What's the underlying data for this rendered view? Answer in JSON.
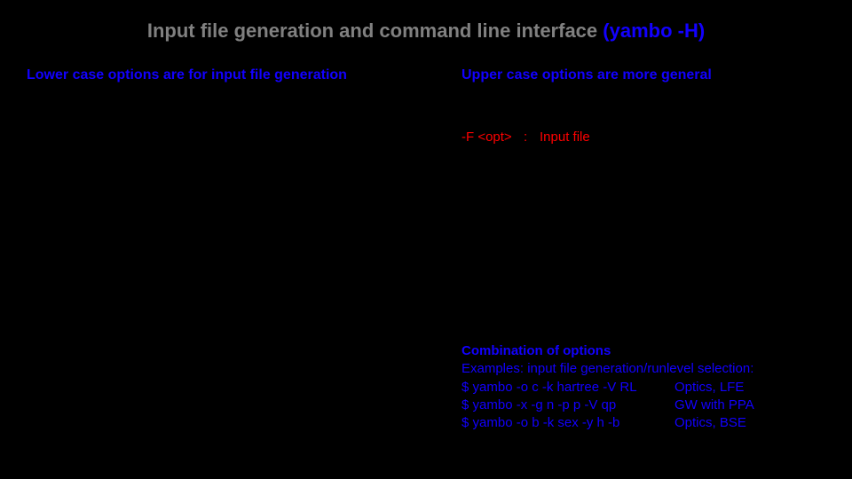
{
  "title": {
    "main": "Input file generation and command line interface ",
    "cmd": "(yambo -H)"
  },
  "headers": {
    "lower": "Lower case options are for input file generation",
    "upper": "Upper case options are more general"
  },
  "optF": {
    "flag": "-F <opt>",
    "sep": ":",
    "desc": "Input file"
  },
  "comb": {
    "hdr": "Combination of options",
    "intro": "Examples:  input file generation/runlevel selection:",
    "rows": [
      {
        "cmd": "$ yambo -o c -k hartree -V RL",
        "desc": "Optics, LFE"
      },
      {
        "cmd": "$ yambo -x -g n -p p -V qp",
        "desc": "GW with PPA"
      },
      {
        "cmd": "$ yambo -o b -k sex -y h -b",
        "desc": "Optics, BSE"
      }
    ]
  }
}
